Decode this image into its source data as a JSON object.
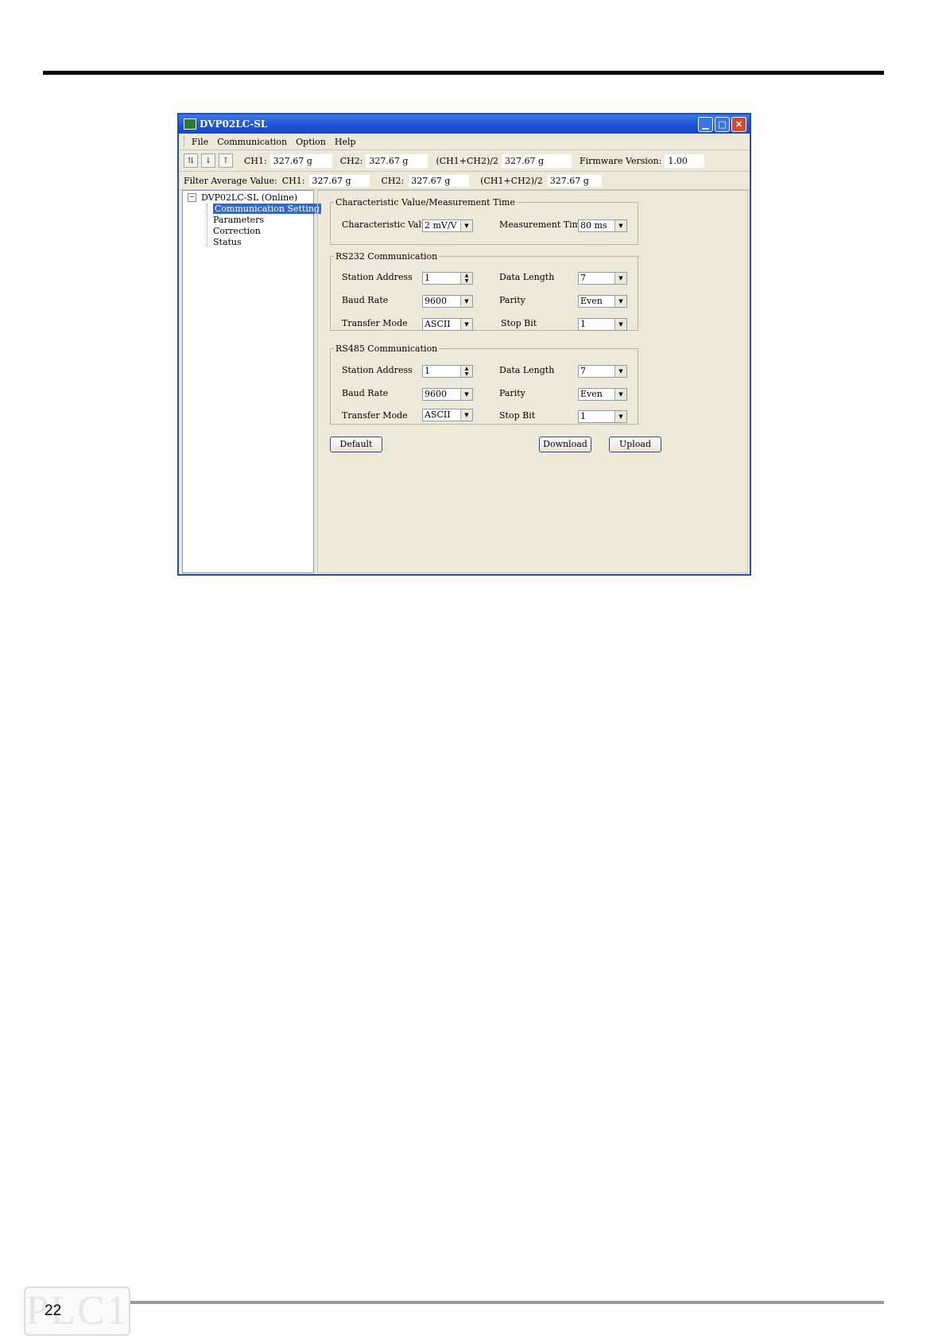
{
  "window": {
    "title": "DVP02LC-SL"
  },
  "menu": [
    "File",
    "Communication",
    "Option",
    "Help"
  ],
  "toolbar": {
    "ch1_label": "CH1:",
    "ch1_value": "327.67 g",
    "ch2_label": "CH2:",
    "ch2_value": "327.67 g",
    "avg_label": "(CH1+CH2)/2",
    "avg_value": "327.67 g",
    "fw_label": "Firmware Version:",
    "fw_value": "1.00"
  },
  "filterbar": {
    "label": "Filter Average Value:",
    "ch1_label": "CH1:",
    "ch1_value": "327.67 g",
    "ch2_label": "CH2:",
    "ch2_value": "327.67 g",
    "avg_label": "(CH1+CH2)/2",
    "avg_value": "327.67 g"
  },
  "tree": {
    "root": "DVP02LC-SL (Online)",
    "items": [
      "Communication Setting",
      "Parameters",
      "Correction",
      "Status"
    ],
    "selected": "Communication Setting"
  },
  "characteristic": {
    "legend": "Characteristic Value/Measurement Time",
    "cv_label": "Characteristic Value",
    "cv_value": "2 mV/V",
    "mt_label": "Measurement Time",
    "mt_value": "80 ms"
  },
  "rs232": {
    "legend": "RS232 Communication",
    "station_label": "Station Address",
    "station_value": "1",
    "datalen_label": "Data Length",
    "datalen_value": "7",
    "baud_label": "Baud Rate",
    "baud_value": "9600",
    "parity_label": "Parity",
    "parity_value": "Even",
    "mode_label": "Transfer Mode",
    "mode_value": "ASCII",
    "stop_label": "Stop Bit",
    "stop_value": "1"
  },
  "rs485": {
    "legend": "RS485 Communication",
    "station_label": "Station Address",
    "station_value": "1",
    "datalen_label": "Data Length",
    "datalen_value": "7",
    "baud_label": "Baud Rate",
    "baud_value": "9600",
    "parity_label": "Parity",
    "parity_value": "Even",
    "mode_label": "Transfer Mode",
    "mode_value": "ASCII",
    "stop_label": "Stop Bit",
    "stop_value": "1"
  },
  "buttons": {
    "default": "Default",
    "download": "Download",
    "upload": "Upload"
  },
  "page": {
    "number": "22",
    "logo": "PLC1"
  }
}
